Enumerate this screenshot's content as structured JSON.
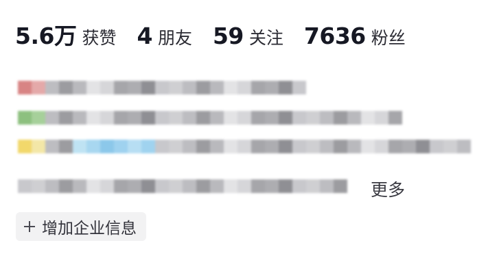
{
  "stats": [
    {
      "value": "5.6万",
      "label": "获赞"
    },
    {
      "value": "4",
      "label": "朋友"
    },
    {
      "value": "59",
      "label": "关注"
    },
    {
      "value": "7636",
      "label": "粉丝"
    }
  ],
  "bio": {
    "more_label": "更多"
  },
  "actions": {
    "add_company_info_label": "增加企业信息",
    "plus_icon": "plus-icon"
  }
}
